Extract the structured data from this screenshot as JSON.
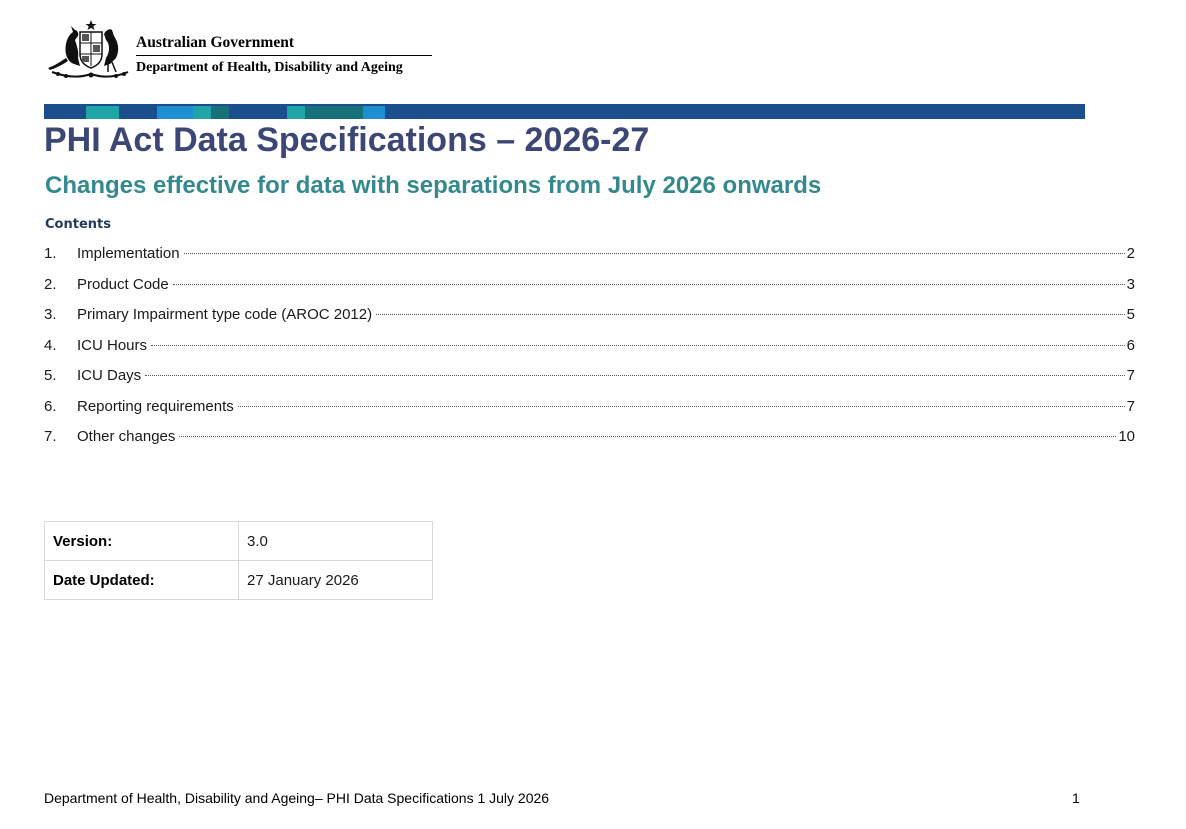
{
  "header": {
    "government": "Australian Government",
    "department": "Department of Health, Disability and Ageing",
    "crest_icon": "coat-of-arms-icon"
  },
  "stripe": {
    "colors": [
      "#1a4f8b",
      "#1fa5a8",
      "#1a4f8b",
      "#1e8fd0",
      "#1fa5a8",
      "#17707a",
      "#1a4f8b",
      "#1fa5a8",
      "#17707a",
      "#1e8fd0",
      "#1a4f8b"
    ]
  },
  "title": "PHI Act Data Specifications – 2026-27",
  "subtitle": "Changes effective for data with separations from July 2026 onwards",
  "contents": {
    "heading": "Contents",
    "items": [
      {
        "num": "1.",
        "label": "Implementation",
        "page": "2"
      },
      {
        "num": "2.",
        "label": "Product Code",
        "page": "3"
      },
      {
        "num": "3.",
        "label": "Primary Impairment type code (AROC 2012)",
        "page": "5"
      },
      {
        "num": "4.",
        "label": "ICU Hours",
        "page": "6"
      },
      {
        "num": "5.",
        "label": "ICU Days",
        "page": "7"
      },
      {
        "num": "6.",
        "label": "Reporting requirements",
        "page": "7"
      },
      {
        "num": "7.",
        "label": "Other changes",
        "page": "10"
      }
    ]
  },
  "info": {
    "version_label": "Version:",
    "version_value": "3.0",
    "date_label": "Date Updated:",
    "date_value": "27 January 2026"
  },
  "footer": {
    "text": "Department of Health, Disability and Ageing– PHI Data Specifications 1 July 2026",
    "page_number": "1"
  },
  "colors": {
    "title": "#3d4775",
    "subtitle": "#34898e",
    "contents_heading": "#243b5e"
  }
}
